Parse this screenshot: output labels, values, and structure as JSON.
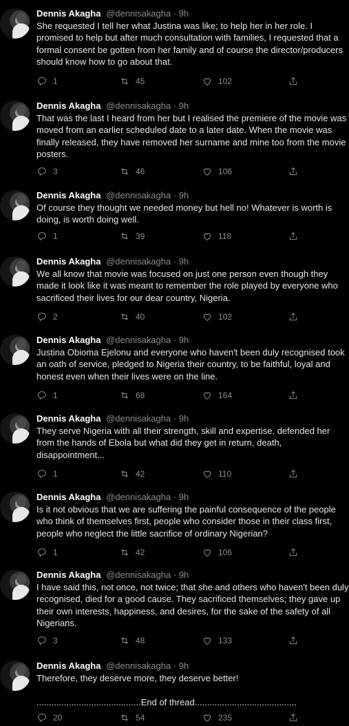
{
  "author": {
    "name": "Dennis Akagha",
    "handle": "@dennisakagha",
    "time": "9h"
  },
  "tweets": [
    {
      "text": "She requested I tell her what Justina was like; to help her in her role. I promised to help but after much consultation with families, I requested that a formal consent be gotten from her family and of course the director/producers should know how to go about that.",
      "replies": "1",
      "retweets": "45",
      "likes": "102"
    },
    {
      "text": "That was the last I heard from her but I realised the premiere of the movie was moved from an earlier scheduled date to a later date. When the movie was finally released, they have removed her surname and mine too from the movie posters.",
      "replies": "3",
      "retweets": "46",
      "likes": "106"
    },
    {
      "text": "Of course they thought we needed money but hell no! Whatever is worth is doing, is worth doing well.",
      "replies": "1",
      "retweets": "39",
      "likes": "118"
    },
    {
      "text": "We all know that movie was focused on just one person even though they made it look like it was meant to remember the role played by everyone who sacrificed their lives for our dear country, Nigeria.",
      "replies": "2",
      "retweets": "40",
      "likes": "102"
    },
    {
      "text": "Justina Obioma Ejelonu and everyone who haven't been duly recognised took an oath of service, pledged to Nigeria their country, to be faithful, loyal and honest even when their lives were on the line.",
      "replies": "1",
      "retweets": "68",
      "likes": "164"
    },
    {
      "text": "They serve Nigeria with all their strength, skill and expertise, defended her from the hands of Ebola but what did they get in return, death, disappointment...",
      "replies": "1",
      "retweets": "42",
      "likes": "110"
    },
    {
      "text": "Is it not obvious that we are suffering the painful consequence of the people who think of themselves first, people who consider those in their class first, people who neglect the little sacrifice of ordinary Nigerian?",
      "replies": "1",
      "retweets": "42",
      "likes": "106"
    },
    {
      "text": "I have said this, not once, not twice; that she and others who haven't been duly recognised, died for a good cause. They sacrificed themselves; they gave up their own interests, happiness, and desires, for the sake of the safety of all Nigerians.",
      "replies": "3",
      "retweets": "48",
      "likes": "133"
    },
    {
      "text": "Therefore, they deserve more, they deserve better!\n\n..........................................End of thread.........................................",
      "replies": "20",
      "retweets": "54",
      "likes": "235"
    }
  ]
}
